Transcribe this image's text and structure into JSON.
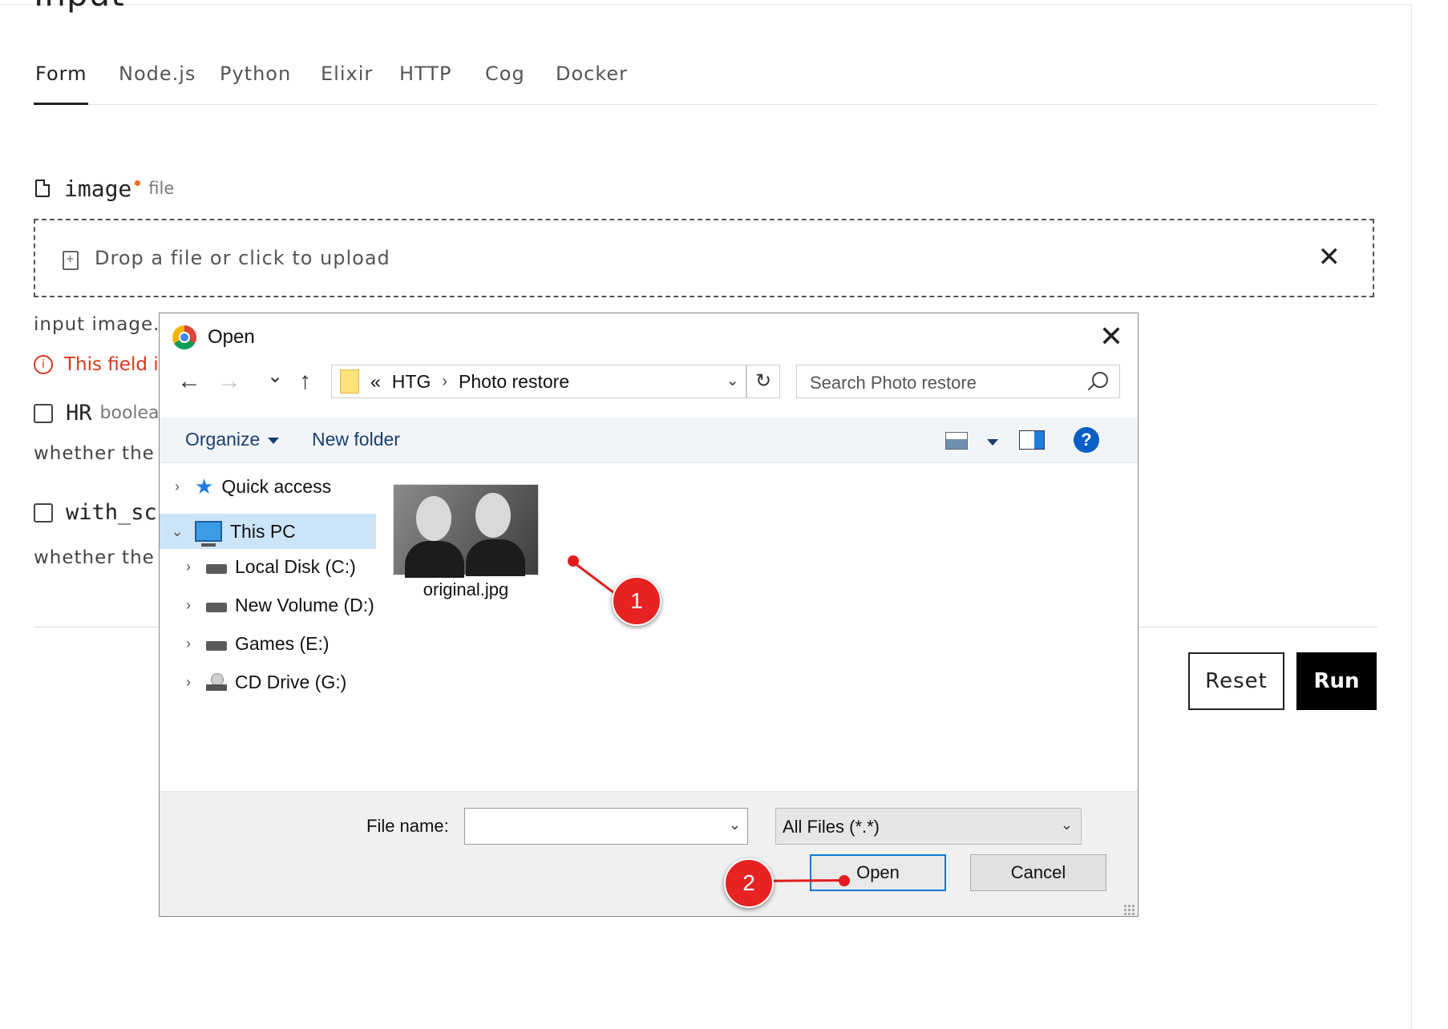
{
  "page": {
    "heading": "Input"
  },
  "tabs": [
    {
      "label": "Form",
      "active": true
    },
    {
      "label": "Node.js"
    },
    {
      "label": "Python"
    },
    {
      "label": "Elixir"
    },
    {
      "label": "HTTP"
    },
    {
      "label": "Cog"
    },
    {
      "label": "Docker"
    }
  ],
  "image_field": {
    "name": "image",
    "type": "file",
    "dropzone_text": "Drop a file or click to upload",
    "close_glyph": "✕",
    "help": "input image.",
    "error": "This field i"
  },
  "hr_field": {
    "name": "HR",
    "type": "boolea",
    "help": "whether the i"
  },
  "with_scale_field": {
    "name": "with_sc",
    "help": "whether the i"
  },
  "actions": {
    "reset": "Reset",
    "run": "Run"
  },
  "dialog": {
    "title": "Open",
    "close_glyph": "✕",
    "nav": {
      "back": "←",
      "forward": "→",
      "recent": "⌄",
      "up": "↑"
    },
    "address": {
      "prefix": "«",
      "segments": [
        "HTG",
        "Photo restore"
      ],
      "separator": "›",
      "dropdown": "⌄"
    },
    "refresh_glyph": "↻",
    "search_placeholder": "Search Photo restore",
    "toolbar": {
      "organize": "Organize",
      "new_folder": "New folder",
      "help": "?"
    },
    "tree": [
      {
        "label": "Quick access",
        "chevron": "›",
        "icon": "star-icon"
      },
      {
        "label": "This PC",
        "chevron": "⌄",
        "icon": "computer-icon",
        "selected": true
      },
      {
        "label": "Local Disk (C:)",
        "chevron": "›",
        "icon": "drive-icon"
      },
      {
        "label": "New Volume (D:)",
        "chevron": "›",
        "icon": "drive-icon"
      },
      {
        "label": "Games (E:)",
        "chevron": "›",
        "icon": "drive-icon"
      },
      {
        "label": "CD Drive (G:)",
        "chevron": "›",
        "icon": "cd-drive-icon"
      }
    ],
    "file": {
      "name": "original.jpg"
    },
    "file_name_label": "File name:",
    "file_name_value": "",
    "file_type": "All Files (*.*)",
    "open_button": "Open",
    "cancel_button": "Cancel"
  },
  "annotations": [
    {
      "number": "1"
    },
    {
      "number": "2"
    }
  ],
  "colors": {
    "error": "#d9371f",
    "accent_orange": "#f26b1d",
    "callout_red": "#e62222",
    "selection_blue": "#cce4f7"
  }
}
